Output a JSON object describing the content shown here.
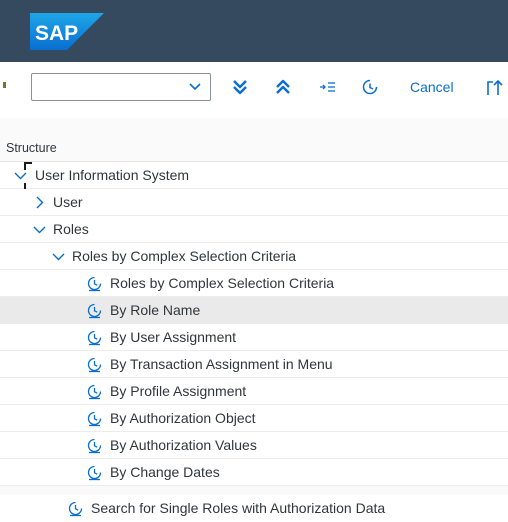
{
  "header": {
    "logo_text": "SAP"
  },
  "toolbar": {
    "cancel_label": "Cancel",
    "icons": [
      "expand-all-icon",
      "collapse-all-icon",
      "indent-list-icon",
      "execute-icon",
      "export-icon"
    ]
  },
  "tree": {
    "header_label": "Structure",
    "items": [
      {
        "label": "User Information System",
        "state": "expanded"
      },
      {
        "label": "User",
        "state": "collapsed"
      },
      {
        "label": "Roles",
        "state": "expanded"
      },
      {
        "label": "Roles by Complex Selection Criteria",
        "state": "expanded"
      },
      {
        "label": "Roles by Complex Selection Criteria",
        "state": "leaf"
      },
      {
        "label": "By Role Name",
        "state": "leaf",
        "selected": true
      },
      {
        "label": "By User Assignment",
        "state": "leaf"
      },
      {
        "label": "By Transaction Assignment in Menu",
        "state": "leaf"
      },
      {
        "label": "By Profile Assignment",
        "state": "leaf"
      },
      {
        "label": "By Authorization Object",
        "state": "leaf"
      },
      {
        "label": "By Authorization Values",
        "state": "leaf"
      },
      {
        "label": "By Change Dates",
        "state": "leaf"
      },
      {
        "label": "Search for Single Roles with Authorization Data",
        "state": "leaf"
      }
    ]
  },
  "colors": {
    "shell": "#354a5f",
    "accent": "#0a6ed1",
    "text": "#32363a",
    "selected_row": "#eaeaea"
  }
}
